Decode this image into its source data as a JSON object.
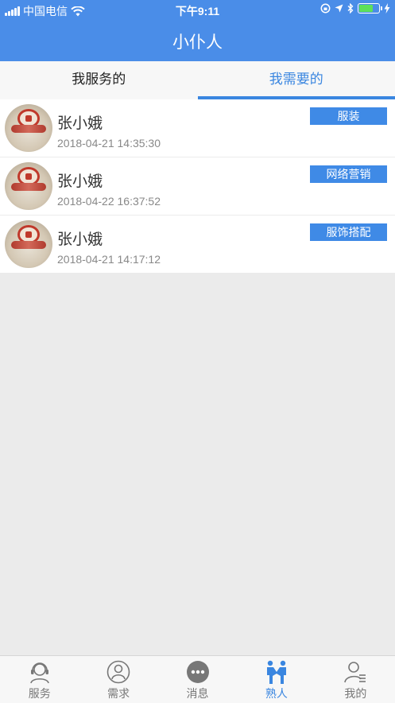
{
  "status_bar": {
    "carrier": "中国电信",
    "time": "下午9:11"
  },
  "nav": {
    "title": "小仆人"
  },
  "tabs": [
    {
      "label": "我服务的",
      "active": false
    },
    {
      "label": "我需要的",
      "active": true
    }
  ],
  "list": [
    {
      "name": "张小娥",
      "time": "2018-04-21 14:35:30",
      "tag": "服装"
    },
    {
      "name": "张小娥",
      "time": "2018-04-22 16:37:52",
      "tag": "网络营销"
    },
    {
      "name": "张小娥",
      "time": "2018-04-21 14:17:12",
      "tag": "服饰搭配"
    }
  ],
  "bottom_nav": [
    {
      "label": "服务",
      "icon": "customer-service-icon",
      "active": false
    },
    {
      "label": "需求",
      "icon": "user-circle-icon",
      "active": false
    },
    {
      "label": "消息",
      "icon": "message-dots-icon",
      "active": false
    },
    {
      "label": "熟人",
      "icon": "handshake-icon",
      "active": true
    },
    {
      "label": "我的",
      "icon": "profile-icon",
      "active": false
    }
  ],
  "colors": {
    "brand": "#4a8de8",
    "tab_active": "#3a86e0",
    "tag_bg": "#3f8ae6"
  }
}
